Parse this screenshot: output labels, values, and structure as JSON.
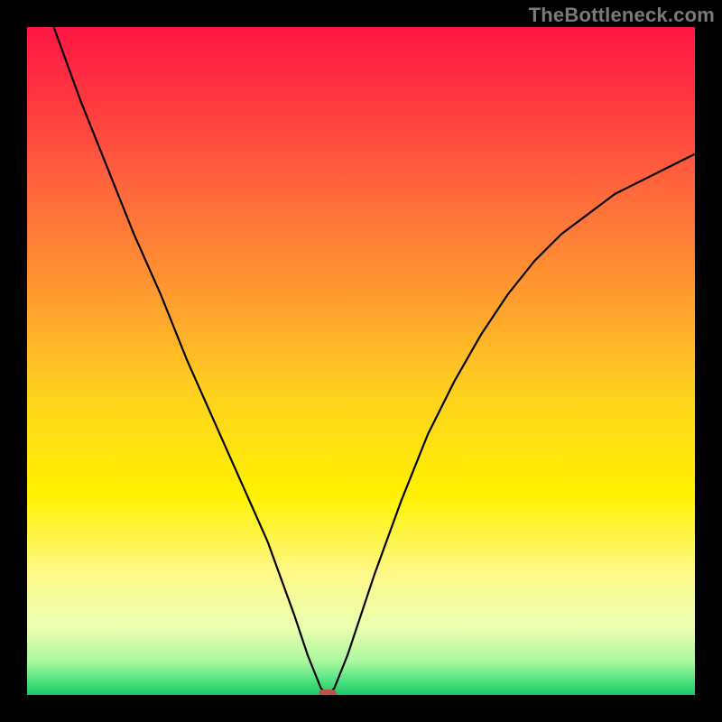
{
  "watermark": "TheBottleneck.com",
  "chart_data": {
    "type": "line",
    "title": "",
    "xlabel": "",
    "ylabel": "",
    "xlim": [
      0,
      100
    ],
    "ylim": [
      0,
      100
    ],
    "grid": false,
    "legend": false,
    "gradient_background": {
      "stops": [
        {
          "pct": 0,
          "color": "#ff1744"
        },
        {
          "pct": 12,
          "color": "#ff3b3f"
        },
        {
          "pct": 25,
          "color": "#ff6a3c"
        },
        {
          "pct": 40,
          "color": "#ff9b2f"
        },
        {
          "pct": 55,
          "color": "#ffd21f"
        },
        {
          "pct": 70,
          "color": "#fff200"
        },
        {
          "pct": 82,
          "color": "#fff88a"
        },
        {
          "pct": 90,
          "color": "#eaffb0"
        },
        {
          "pct": 95,
          "color": "#a9f7a0"
        },
        {
          "pct": 98,
          "color": "#4de27e"
        },
        {
          "pct": 100,
          "color": "#18c868"
        }
      ]
    },
    "series": [
      {
        "name": "bottleneck-curve",
        "color": "#000000",
        "x": [
          4,
          8,
          12,
          16,
          20,
          24,
          28,
          32,
          36,
          40,
          42,
          44,
          45,
          46,
          48,
          52,
          56,
          60,
          64,
          68,
          72,
          76,
          80,
          84,
          88,
          92,
          96,
          100
        ],
        "values": [
          100,
          89,
          79,
          69,
          60,
          50,
          41,
          32,
          23,
          12,
          6,
          1,
          0,
          1,
          6,
          18,
          29,
          39,
          47,
          54,
          60,
          65,
          69,
          72,
          75,
          77,
          79,
          81
        ]
      }
    ],
    "marker": {
      "x": 45,
      "y": 0,
      "color": "#c0504d"
    }
  }
}
